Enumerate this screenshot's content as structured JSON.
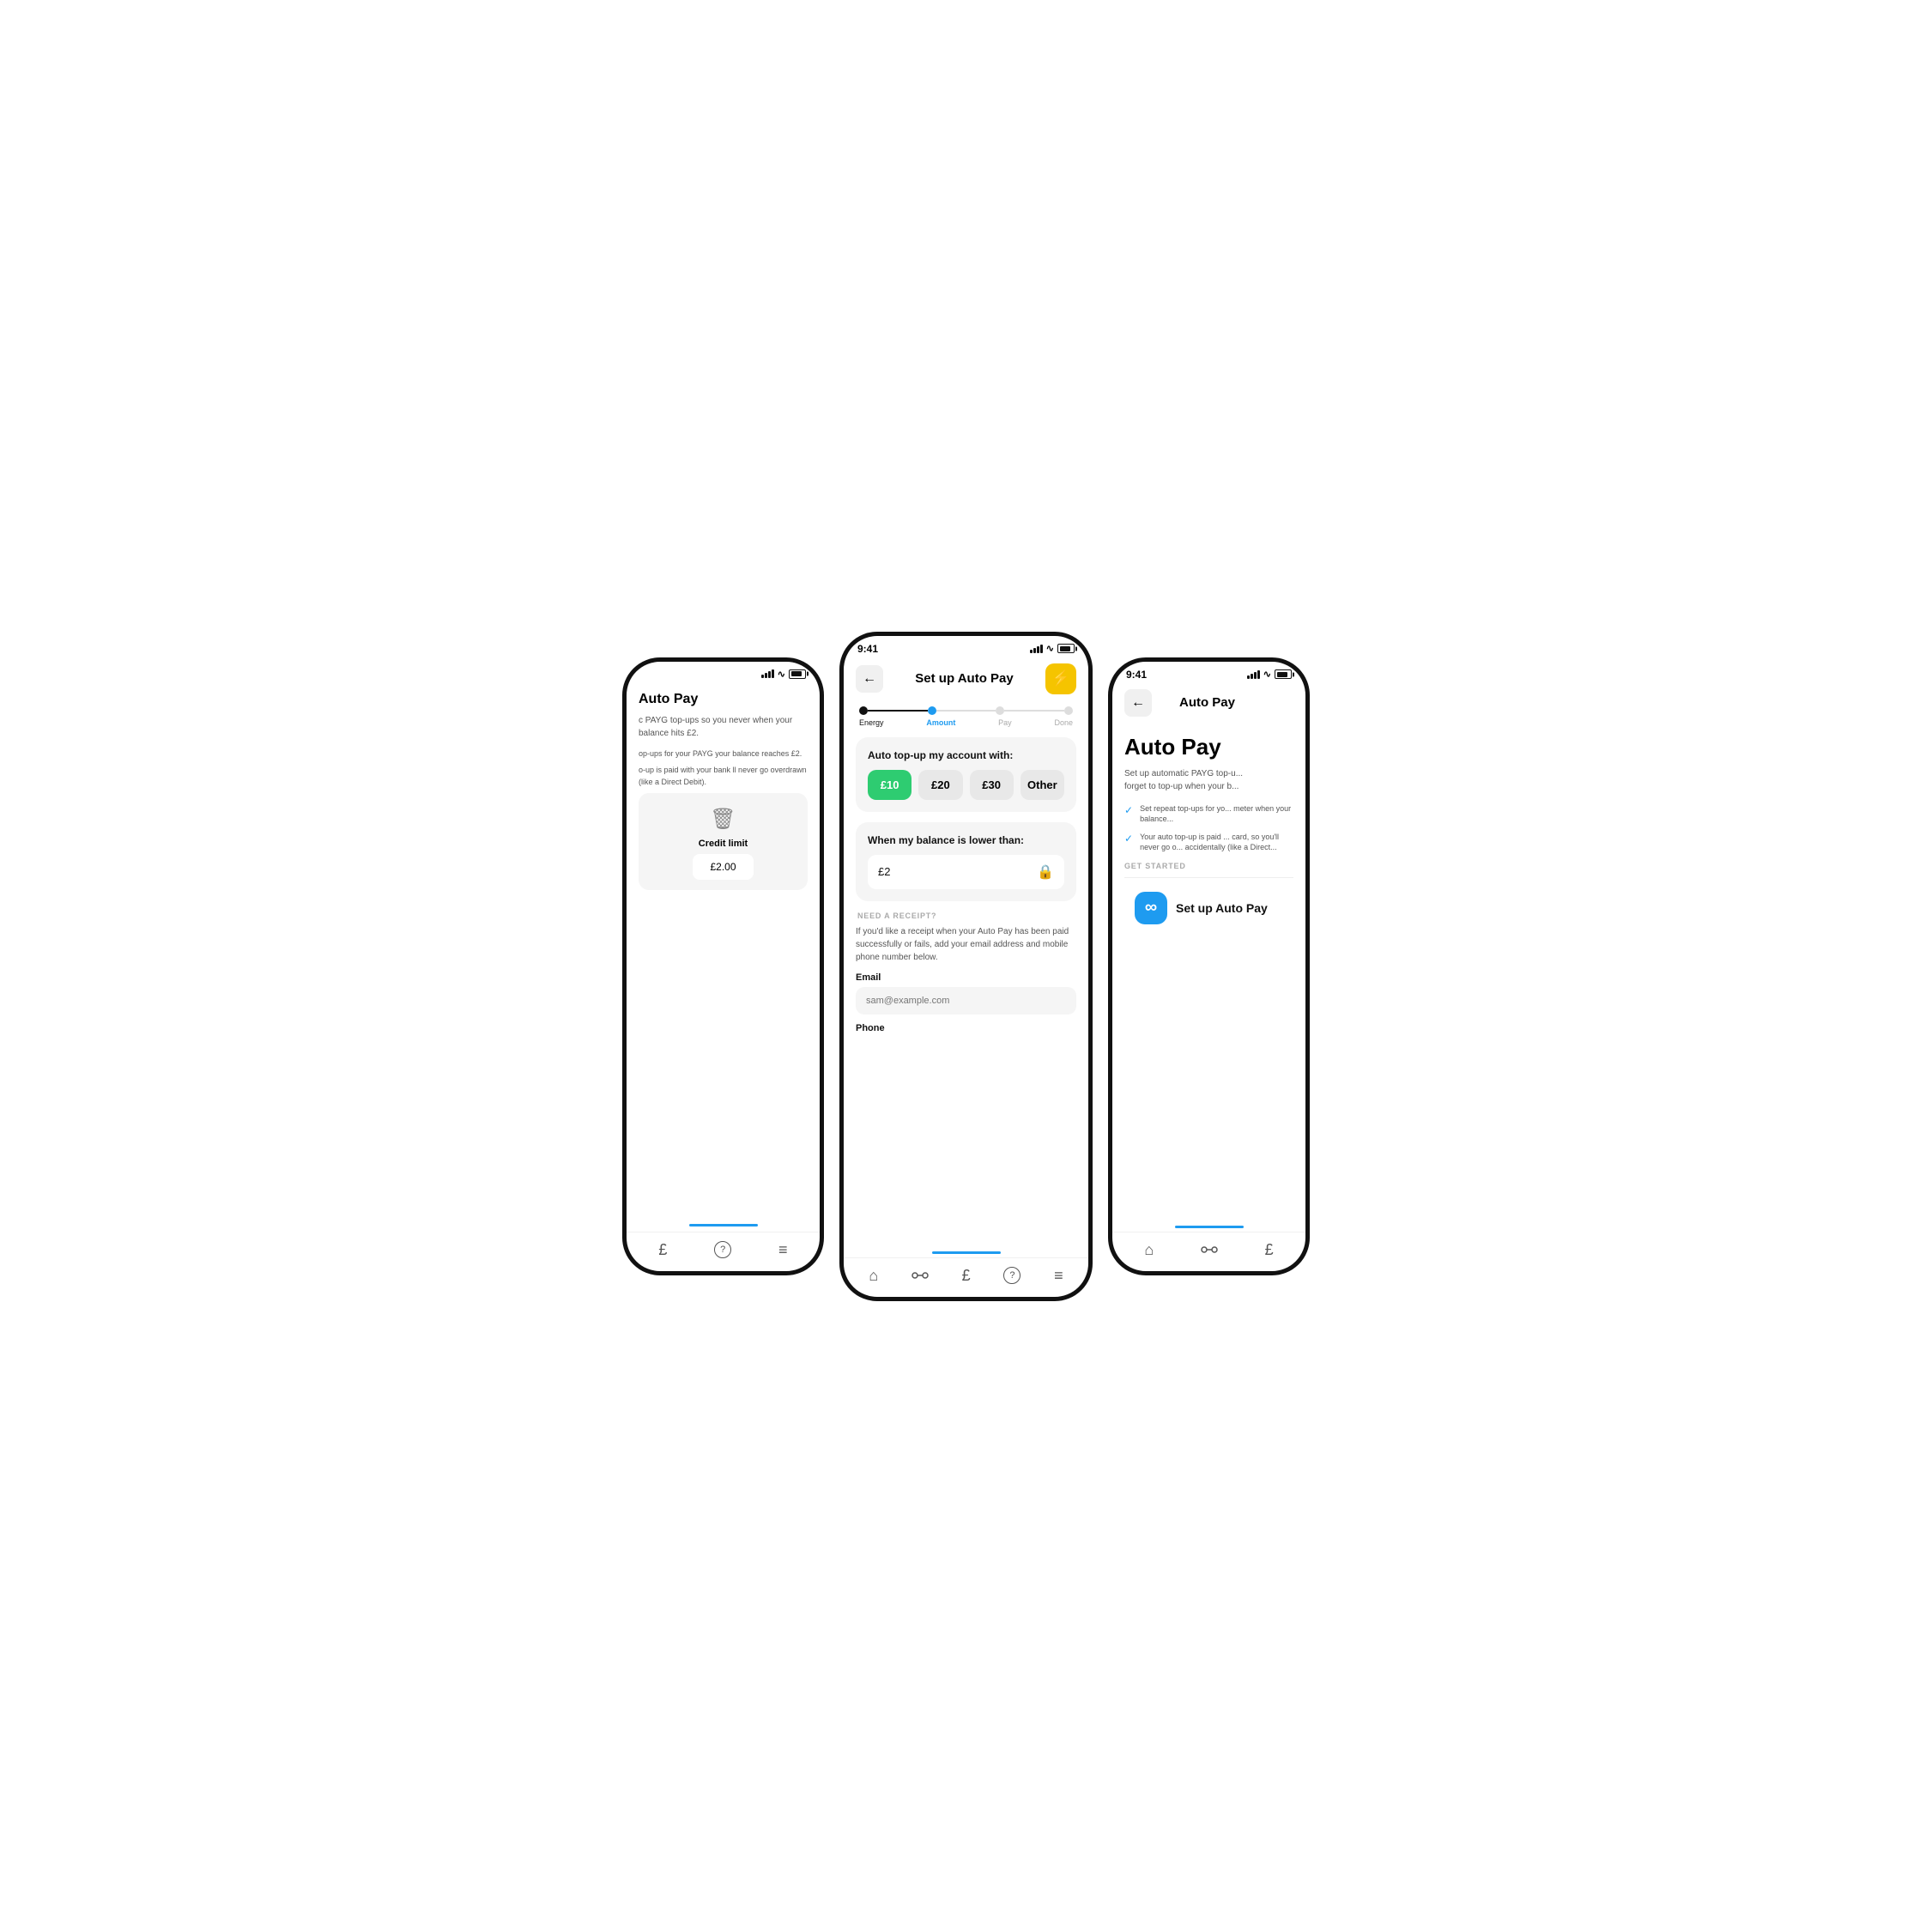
{
  "scene": {
    "bg": "#ffffff"
  },
  "leftPhone": {
    "title": "Auto Pay",
    "bodyText1": "c PAYG top-ups so you never when your balance hits £2.",
    "bodyText2": "op-ups for your PAYG your balance reaches £2.",
    "bodyText3": "o-up is paid with your bank ll never go overdrawn (like a Direct Debit).",
    "creditLimitLabel": "Credit limit",
    "creditLimitValue": "£2.00",
    "bottomNavIcons": [
      "£",
      "?",
      "≡"
    ]
  },
  "centerPhone": {
    "statusTime": "9:41",
    "navBackLabel": "←",
    "navTitle": "Set up Auto Pay",
    "navIconSymbol": "⚡",
    "steps": [
      {
        "label": "Energy",
        "state": "done"
      },
      {
        "label": "Amount",
        "state": "active"
      },
      {
        "label": "Pay",
        "state": "inactive"
      },
      {
        "label": "Done",
        "state": "inactive"
      }
    ],
    "autoTopUpLabel": "Auto top-up my account with:",
    "amountOptions": [
      {
        "value": "£10",
        "selected": true
      },
      {
        "value": "£20",
        "selected": false
      },
      {
        "value": "£30",
        "selected": false
      },
      {
        "value": "Other",
        "selected": false
      }
    ],
    "balanceLabel": "When my balance is lower than:",
    "balanceValue": "£2",
    "receiptSectionLabel": "Need a receipt?",
    "receiptDesc": "If you'd like a receipt when your Auto Pay has been paid successfully or fails, add your email address and mobile phone number below.",
    "emailLabel": "Email",
    "emailPlaceholder": "sam@example.com",
    "phoneLabelText": "Phone",
    "bottomNavIcons": [
      "🏠",
      "⬡",
      "£",
      "?",
      "≡"
    ]
  },
  "rightPhone": {
    "statusTime": "9:41",
    "navBackLabel": "←",
    "navTitle": "Auto Pay",
    "heading": "Auto Pay",
    "descText": "Set up automatic PAYG top-u... forget to top-up when your b...",
    "checkItems": [
      "Set repeat top-ups for yo... meter when your balance...",
      "Your auto top-up is paid ... card, so you'll never go o... accidentally (like a Direct..."
    ],
    "getStartedLabel": "Get Started",
    "setupBtnLabel": "Set up Auto Pay",
    "bottomNavIcons": [
      "🏠",
      "⬡",
      "£"
    ]
  },
  "icons": {
    "back": "←",
    "lightning": "⚡",
    "lock": "🔒",
    "trash": "🗑",
    "infinity": "∞",
    "check": "✓"
  }
}
